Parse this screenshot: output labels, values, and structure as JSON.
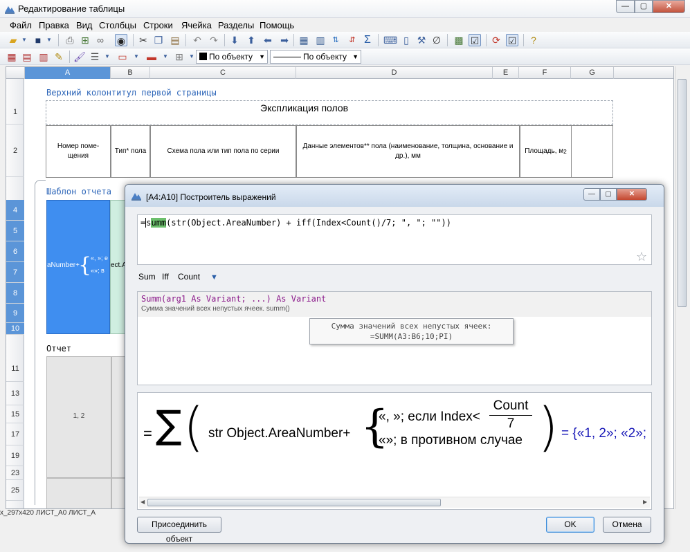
{
  "main_window": {
    "title": "Редактирование таблицы",
    "menu": [
      "Файл",
      "Правка",
      "Вид",
      "Столбцы",
      "Строки",
      "Ячейка",
      "Разделы",
      "Помощь"
    ],
    "toolbar": {
      "fill_dropdown": "По объекту",
      "line_dropdown": "По объекту"
    }
  },
  "sheet": {
    "columns": [
      "A",
      "B",
      "C",
      "D",
      "E",
      "F",
      "G"
    ],
    "rows": [
      "1",
      "2",
      "4",
      "5",
      "6",
      "7",
      "8",
      "9",
      "10",
      "11",
      "13",
      "15",
      "17",
      "19",
      "23",
      "25"
    ],
    "header_band_title": "Верхний колонтитул первой страницы",
    "table_title": "Экспликация полов",
    "headers": {
      "room_number": "Номер поме-щения",
      "floor_type": "Тип* пола",
      "floor_scheme": "Схема пола или тип пола по серии",
      "floor_elements": "Данные элементов** пола (наименование, толщина, основание и др.), мм",
      "area": "Площадь, м",
      "area_sup": "2"
    },
    "template_band_title": "Шаблон отчета",
    "template_cell_text": "aNumber+",
    "template_cell_part1": "«, »; е",
    "template_cell_part2": "«»; в",
    "template_cell_b": "ect.A",
    "report_band_title": "Отчет",
    "report_cell_value": "1, 2",
    "sheet_tabs": "x_297x420  ЛИСТ_A0  ЛИСТ_A"
  },
  "dialog": {
    "title": "[A4:A10] Построитель выражений",
    "expression": {
      "prefix": "=",
      "cursor_char": "s",
      "highlight": "umm",
      "rest": "(str(Object.AreaNumber) + iff(Index<Count()/7; \", \"; \"\"))"
    },
    "functions": [
      "Sum",
      "Iff",
      "Count"
    ],
    "hint": {
      "signature": "Summ(arg1 As Variant; ...) As Variant",
      "description": "Сумма значений всех непустых ячеек. summ()",
      "tooltip_line1": "Сумма значений всех непустых ячеек:",
      "tooltip_line2": "=SUMM(A3:B6;10;PI)"
    },
    "preview": {
      "equals": "=",
      "sigma": "∑",
      "str_part": "str Object.AreaNumber+",
      "case1": "«, »; если Index<",
      "frac_num": "Count",
      "frac_den": "7",
      "case2": "«»; в противном случае",
      "result": "= {«1, 2»; «2»;"
    },
    "buttons": {
      "attach": "Присоединить объект",
      "ok": "OK",
      "cancel": "Отмена"
    }
  }
}
